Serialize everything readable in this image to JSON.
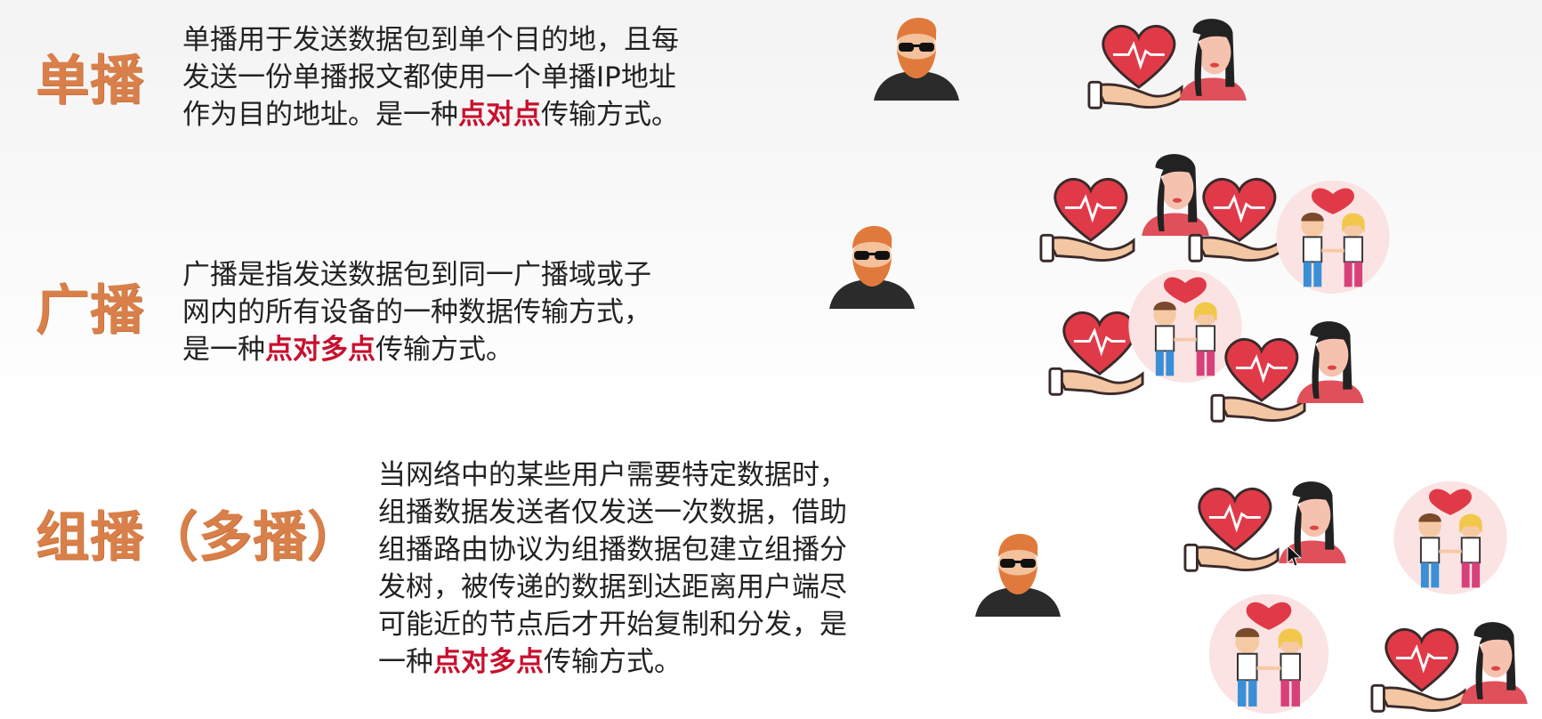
{
  "slide": {
    "sections": [
      {
        "title": "单播",
        "lines": [
          "单播用于发送数据包到单个目的地，且每",
          "发送一份单播报文都使用一个单播IP地址",
          "作为目的地址。是一种"
        ],
        "highlight": "点对点",
        "tail": "传输方式。"
      },
      {
        "title": "广播",
        "lines": [
          "广播是指发送数据包到同一广播域或子",
          "网内的所有设备的一种数据传输方式，",
          "是一种"
        ],
        "highlight": "点对多点",
        "tail": "传输方式。"
      },
      {
        "title": "组播（多播）",
        "lines": [
          "当网络中的某些用户需要特定数据时，",
          "组播数据发送者仅发送一次数据，借助",
          "组播路由协议为组播数据包建立组播分",
          "发树，被传递的数据到达距离用户端尽",
          "可能近的节点后才开始复制和分发，是",
          "一种"
        ],
        "highlight": "点对多点",
        "tail": "传输方式。"
      }
    ]
  },
  "colors": {
    "title": "#d9804a",
    "highlight": "#c8102e",
    "heart": "#e03a48",
    "hair": "#e07a3c"
  },
  "icons": {
    "sender": "man-with-sunglasses-icon",
    "receiver_heart": "heart-in-hand-icon",
    "receiver_woman": "woman-icon",
    "receiver_couple": "couple-with-heart-icon",
    "cursor": "mouse-cursor-icon"
  }
}
